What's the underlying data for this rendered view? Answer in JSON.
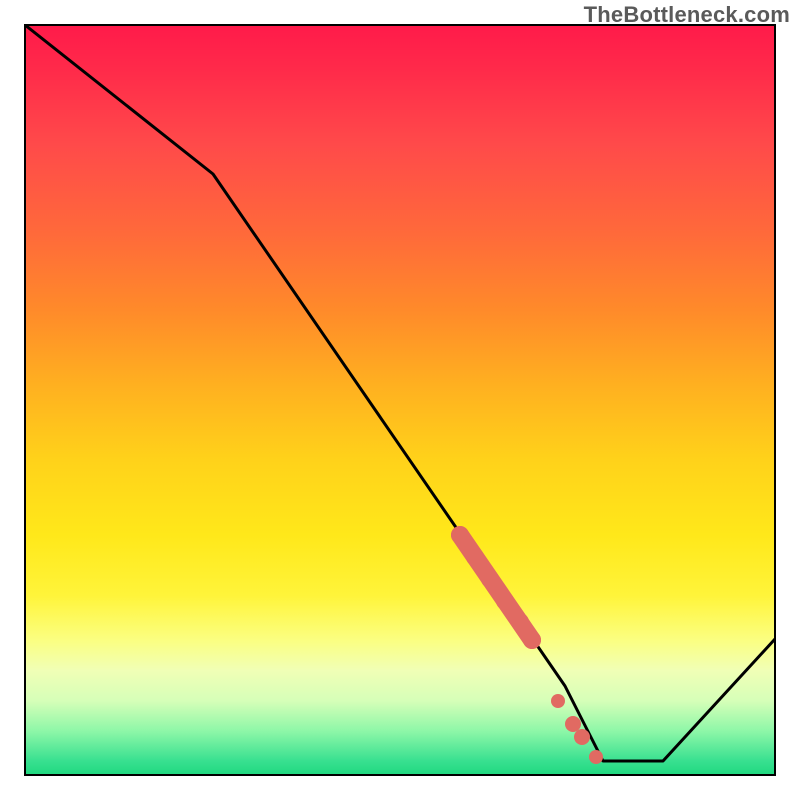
{
  "attribution": "TheBottleneck.com",
  "chart_data": {
    "type": "line",
    "title": "",
    "xlabel": "",
    "ylabel": "",
    "xlim": [
      0,
      100
    ],
    "ylim": [
      0,
      100
    ],
    "series": [
      {
        "name": "bottleneck-curve",
        "x": [
          0,
          25,
          72,
          77,
          85,
          100
        ],
        "values": [
          100,
          80,
          12,
          2,
          2,
          18
        ]
      }
    ],
    "highlight_segment": {
      "name": "highlight-band",
      "color": "#e16a62",
      "points_x": [
        58,
        60,
        62,
        64,
        66,
        68,
        71,
        73,
        76
      ],
      "points_y": [
        32,
        30,
        27,
        24,
        21,
        18,
        10,
        7,
        2.5
      ]
    },
    "gradient_stops": [
      {
        "pos": 0.0,
        "color": "#ff1a4a"
      },
      {
        "pos": 0.5,
        "color": "#ffd21a"
      },
      {
        "pos": 0.82,
        "color": "#fbff82"
      },
      {
        "pos": 1.0,
        "color": "#1ed87e"
      }
    ]
  }
}
